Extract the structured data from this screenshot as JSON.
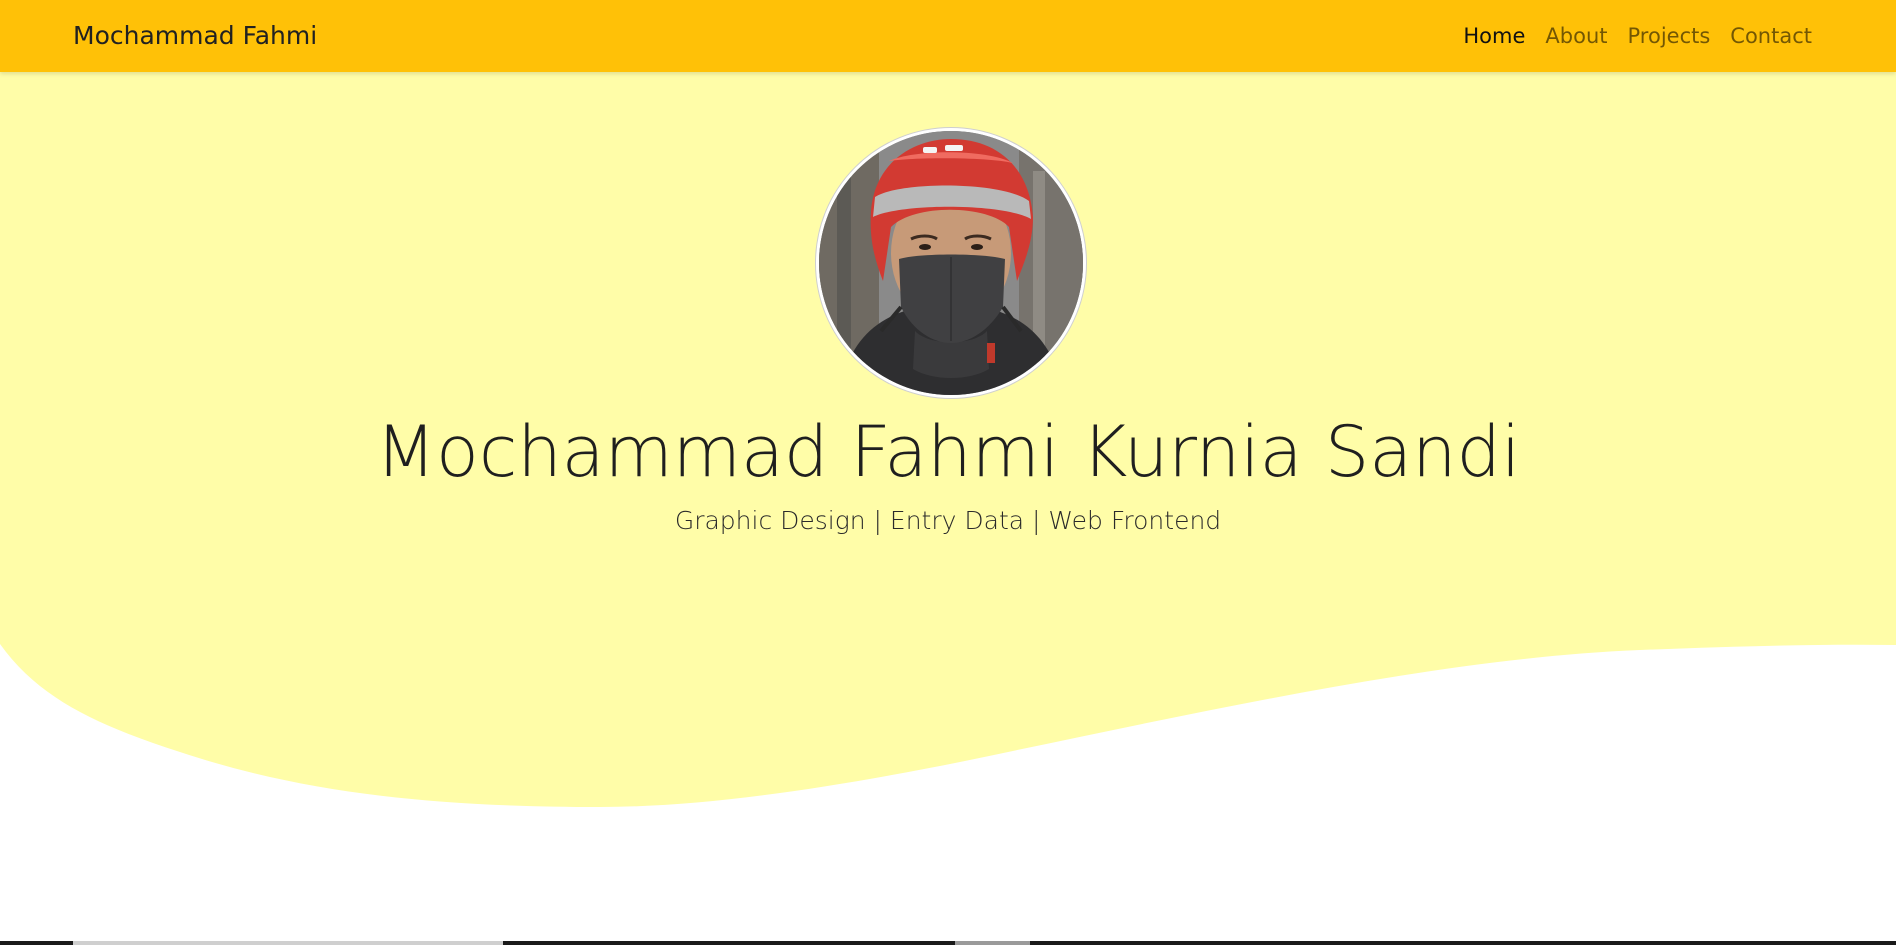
{
  "navbar": {
    "brand": "Mochammad Fahmi",
    "links": [
      {
        "label": "Home",
        "active": true
      },
      {
        "label": "About",
        "active": false
      },
      {
        "label": "Projects",
        "active": false
      },
      {
        "label": "Contact",
        "active": false
      }
    ]
  },
  "hero": {
    "title": "Mochammad Fahmi Kurnia Sandi",
    "subtitle": "Graphic Design | Entry Data | Web Frontend",
    "avatar_icon": "profile-photo"
  },
  "colors": {
    "navbar_bg": "#ffc107",
    "hero_bg": "#fffda8",
    "page_bg": "#ffffff"
  }
}
